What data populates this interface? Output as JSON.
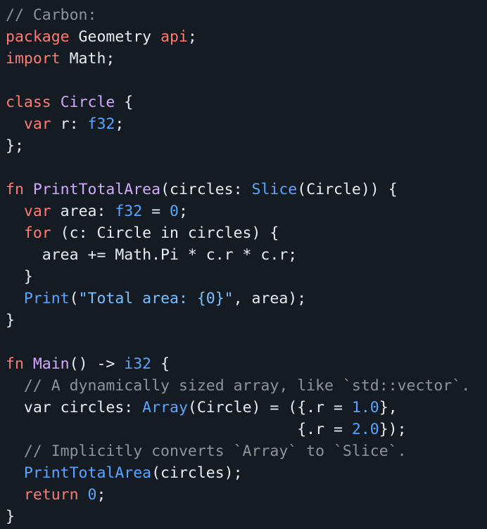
{
  "editor": {
    "language": "Carbon",
    "background_color": "#151b23",
    "colors": {
      "plain": "#e6edf3",
      "comment": "#8b949e",
      "keyword": "#ff7b72",
      "type": "#d2a8ff",
      "builtin_type": "#58a6ff",
      "number": "#58a6ff",
      "string": "#79c0ff",
      "function": "#58a6ff"
    },
    "plain_text": "// Carbon:\npackage Geometry api;\nimport Math;\n\nclass Circle {\n  var r: f32;\n};\n\nfn PrintTotalArea(circles: Slice(Circle)) {\n  var area: f32 = 0;\n  for (c: Circle in circles) {\n    area += Math.Pi * c.r * c.r;\n  }\n  Print(\"Total area: {0}\", area);\n}\n\nfn Main() -> i32 {\n  // A dynamically sized array, like `std::vector`.\n  var circles: Array(Circle) = ({.r = 1.0},\n                                {.r = 2.0});\n  // Implicitly converts `Array` to `Slice`.\n  PrintTotalArea(circles);\n  return 0;\n}",
    "lines": [
      {
        "n": 1,
        "tokens": [
          {
            "t": "// Carbon:",
            "c": "comment"
          }
        ]
      },
      {
        "n": 2,
        "tokens": [
          {
            "t": "package",
            "c": "keyword"
          },
          {
            "t": " Geometry ",
            "c": "plain"
          },
          {
            "t": "api",
            "c": "keyword"
          },
          {
            "t": ";",
            "c": "plain"
          }
        ]
      },
      {
        "n": 3,
        "tokens": [
          {
            "t": "import",
            "c": "keyword"
          },
          {
            "t": " Math;",
            "c": "plain"
          }
        ]
      },
      {
        "n": 4,
        "tokens": []
      },
      {
        "n": 5,
        "tokens": [
          {
            "t": "class",
            "c": "keyword"
          },
          {
            "t": " ",
            "c": "plain"
          },
          {
            "t": "Circle",
            "c": "type"
          },
          {
            "t": " {",
            "c": "plain"
          }
        ]
      },
      {
        "n": 6,
        "tokens": [
          {
            "t": "  ",
            "c": "plain"
          },
          {
            "t": "var",
            "c": "keyword"
          },
          {
            "t": " r: ",
            "c": "plain"
          },
          {
            "t": "f32",
            "c": "builtin"
          },
          {
            "t": ";",
            "c": "plain"
          }
        ]
      },
      {
        "n": 7,
        "tokens": [
          {
            "t": "};",
            "c": "plain"
          }
        ]
      },
      {
        "n": 8,
        "tokens": []
      },
      {
        "n": 9,
        "tokens": [
          {
            "t": "fn",
            "c": "keyword"
          },
          {
            "t": " ",
            "c": "plain"
          },
          {
            "t": "PrintTotalArea",
            "c": "type"
          },
          {
            "t": "(circles: ",
            "c": "plain"
          },
          {
            "t": "Slice",
            "c": "builtin"
          },
          {
            "t": "(Circle)) {",
            "c": "plain"
          }
        ]
      },
      {
        "n": 10,
        "tokens": [
          {
            "t": "  ",
            "c": "plain"
          },
          {
            "t": "var",
            "c": "keyword"
          },
          {
            "t": " area: ",
            "c": "plain"
          },
          {
            "t": "f32",
            "c": "builtin"
          },
          {
            "t": " = ",
            "c": "plain"
          },
          {
            "t": "0",
            "c": "number"
          },
          {
            "t": ";",
            "c": "plain"
          }
        ]
      },
      {
        "n": 11,
        "tokens": [
          {
            "t": "  ",
            "c": "plain"
          },
          {
            "t": "for",
            "c": "keyword"
          },
          {
            "t": " (c: Circle in circles) {",
            "c": "plain"
          }
        ]
      },
      {
        "n": 12,
        "tokens": [
          {
            "t": "    area += Math.Pi * c.r * c.r;",
            "c": "plain"
          }
        ]
      },
      {
        "n": 13,
        "tokens": [
          {
            "t": "  }",
            "c": "plain"
          }
        ]
      },
      {
        "n": 14,
        "tokens": [
          {
            "t": "  ",
            "c": "plain"
          },
          {
            "t": "Print",
            "c": "func"
          },
          {
            "t": "(",
            "c": "plain"
          },
          {
            "t": "\"Total area: {0}\"",
            "c": "string"
          },
          {
            "t": ", area);",
            "c": "plain"
          }
        ]
      },
      {
        "n": 15,
        "tokens": [
          {
            "t": "}",
            "c": "plain"
          }
        ]
      },
      {
        "n": 16,
        "tokens": []
      },
      {
        "n": 17,
        "tokens": [
          {
            "t": "fn",
            "c": "keyword"
          },
          {
            "t": " ",
            "c": "plain"
          },
          {
            "t": "Main",
            "c": "type"
          },
          {
            "t": "() -> ",
            "c": "plain"
          },
          {
            "t": "i32",
            "c": "builtin"
          },
          {
            "t": " {",
            "c": "plain"
          }
        ]
      },
      {
        "n": 18,
        "tokens": [
          {
            "t": "  // A dynamically sized array, like `std::vector`.",
            "c": "comment"
          }
        ]
      },
      {
        "n": 19,
        "tokens": [
          {
            "t": "  var circles: ",
            "c": "plain"
          },
          {
            "t": "Array",
            "c": "builtin"
          },
          {
            "t": "(Circle) = ({.r = ",
            "c": "plain"
          },
          {
            "t": "1.0",
            "c": "number"
          },
          {
            "t": "},",
            "c": "plain"
          }
        ]
      },
      {
        "n": 20,
        "tokens": [
          {
            "t": "                                {.r = ",
            "c": "plain"
          },
          {
            "t": "2.0",
            "c": "number"
          },
          {
            "t": "});",
            "c": "plain"
          }
        ]
      },
      {
        "n": 21,
        "tokens": [
          {
            "t": "  // Implicitly converts `Array` to `Slice`.",
            "c": "comment"
          }
        ]
      },
      {
        "n": 22,
        "tokens": [
          {
            "t": "  ",
            "c": "plain"
          },
          {
            "t": "PrintTotalArea",
            "c": "func"
          },
          {
            "t": "(circles);",
            "c": "plain"
          }
        ]
      },
      {
        "n": 23,
        "tokens": [
          {
            "t": "  ",
            "c": "plain"
          },
          {
            "t": "return",
            "c": "keyword"
          },
          {
            "t": " ",
            "c": "plain"
          },
          {
            "t": "0",
            "c": "number"
          },
          {
            "t": ";",
            "c": "plain"
          }
        ]
      },
      {
        "n": 24,
        "tokens": [
          {
            "t": "}",
            "c": "plain"
          }
        ]
      }
    ]
  }
}
